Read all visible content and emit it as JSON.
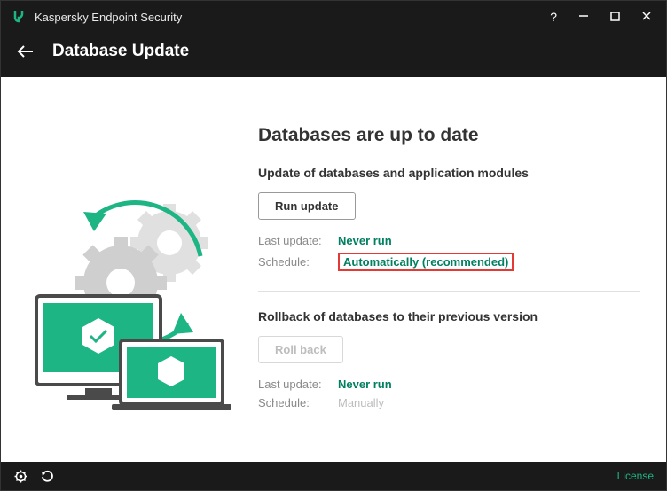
{
  "app": {
    "title": "Kaspersky Endpoint Security",
    "page_title": "Database Update"
  },
  "update": {
    "heading": "Databases are up to date",
    "section_title": "Update of databases and application modules",
    "run_button": "Run update",
    "last_update_label": "Last update:",
    "last_update_value": "Never run",
    "schedule_label": "Schedule:",
    "schedule_value": "Automatically (recommended)"
  },
  "rollback": {
    "section_title": "Rollback of databases to their previous version",
    "button": "Roll back",
    "last_update_label": "Last update:",
    "last_update_value": "Never run",
    "schedule_label": "Schedule:",
    "schedule_value": "Manually"
  },
  "footer": {
    "license": "License"
  }
}
